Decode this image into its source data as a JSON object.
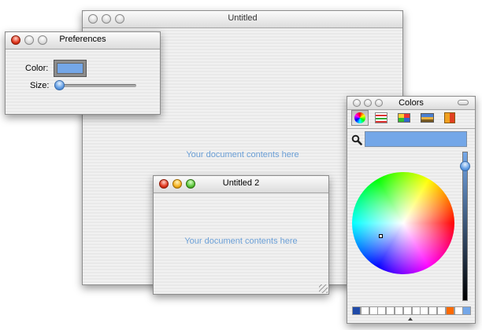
{
  "windows": {
    "untitled": {
      "title": "Untitled",
      "content_placeholder": "Your document contents here"
    },
    "preferences": {
      "title": "Preferences",
      "color_label": "Color:",
      "size_label": "Size:",
      "color_value": "#74a7e8",
      "size_value": 0.0
    },
    "untitled2": {
      "title": "Untitled 2",
      "content_placeholder": "Your document contents here"
    },
    "colors": {
      "title": "Colors",
      "toolbar": [
        {
          "icon": "color-wheel-icon",
          "selected": true
        },
        {
          "icon": "color-sliders-icon",
          "selected": false
        },
        {
          "icon": "color-palettes-icon",
          "selected": false
        },
        {
          "icon": "image-palettes-icon",
          "selected": false
        },
        {
          "icon": "crayons-icon",
          "selected": false
        }
      ],
      "current_color": "#74a7e8",
      "brightness": 0.93,
      "swatches": [
        "#1f4aa8",
        "#ffffff",
        "#ffffff",
        "#ffffff",
        "#ffffff",
        "#ffffff",
        "#ffffff",
        "#ffffff",
        "#ffffff",
        "#ffffff",
        "#ffffff",
        "#ff6a00",
        "#ffffff",
        "#74a7e8"
      ]
    }
  },
  "colors": {
    "accent": "#74a7e8",
    "placeholder_text": "#6b9fd6"
  }
}
